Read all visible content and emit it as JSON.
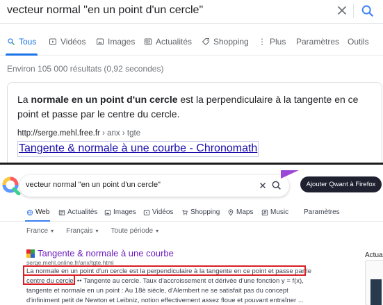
{
  "google": {
    "query": "vecteur normal \"en un point d'un cercle\"",
    "tabs": [
      {
        "label": "Tous",
        "icon": "search-icon",
        "active": true
      },
      {
        "label": "Vidéos",
        "icon": "video-icon"
      },
      {
        "label": "Images",
        "icon": "image-icon"
      },
      {
        "label": "Actualités",
        "icon": "news-icon"
      },
      {
        "label": "Shopping",
        "icon": "tag-icon"
      },
      {
        "label": "Plus",
        "icon": "more-vert-icon"
      },
      {
        "label": "Paramètres"
      },
      {
        "label": "Outils"
      }
    ],
    "stats": "Environ 105 000 résultats (0,92 secondes)",
    "snippet": {
      "prefix": "La ",
      "bold": "normale en un point d'un cercle",
      "suffix": " est la perpendiculaire à la tangente en ce point et passe par le centre du cercle."
    },
    "cite": {
      "domain": "http://serge.mehl.free.fr",
      "path": " › anx › tgte"
    },
    "link_title": "Tangente & normale à une courbe - Chronomath"
  },
  "qwant": {
    "query": "vecteur normal \"en un point d'un cercle\"",
    "add_button": "Ajouter Qwant à Firefox",
    "tabs": [
      {
        "label": "Web",
        "icon": "globe-icon",
        "active": true
      },
      {
        "label": "Actualités",
        "icon": "news-icon"
      },
      {
        "label": "Images",
        "icon": "image-icon"
      },
      {
        "label": "Vidéos",
        "icon": "video-icon"
      },
      {
        "label": "Shopping",
        "icon": "cart-icon"
      },
      {
        "label": "Maps",
        "icon": "pin-icon"
      },
      {
        "label": "Music",
        "icon": "music-icon"
      },
      {
        "label": "Paramètres"
      }
    ],
    "filters": [
      "France",
      "Français",
      "Toute période"
    ],
    "result": {
      "title": "Tangente & normale à une courbe",
      "url": "serge.mehl.online.fr/anx/tgte.html",
      "desc_line1": "La normale en un point d'un cercle est la perpendiculaire à la tangente en ce point et passe par le",
      "desc_line2": "centre du cercle.",
      "desc_rest": " •• Tangente au cercle. Taux d'accroissement et dérivée d'une fonction y = f(x),",
      "desc_line3": "tangente et normale en un point : Au 18è siècle, d'Alembert ne se satisfait pas du concept",
      "desc_line4": "d'infiniment petit de Newton et Leibniz, notion effectivement assez floue et pouvant entraîner ..."
    },
    "side_label": "Actua"
  },
  "colors": {
    "google_blue": "#1a73e8",
    "google_link": "#1a0dab",
    "qwant_visited": "#6b1bbf",
    "highlight_red": "#d81f26",
    "qwant_button": "#1f2030"
  }
}
